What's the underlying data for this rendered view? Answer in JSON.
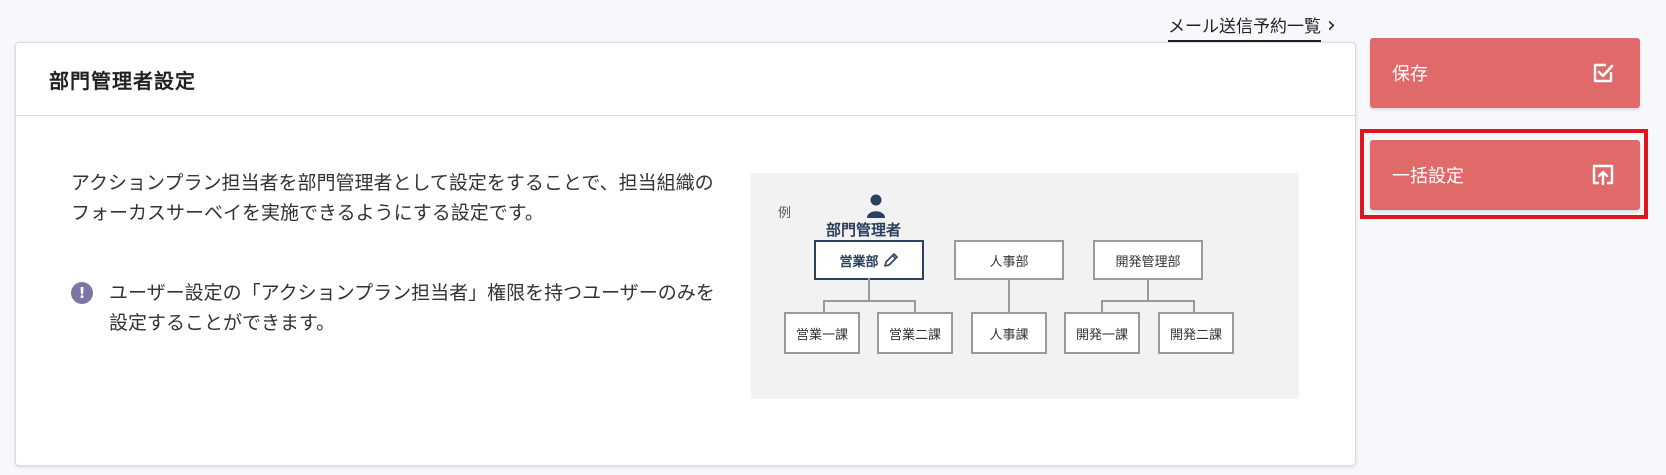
{
  "header_link": {
    "label": "メール送信予約一覧",
    "chevron": "›"
  },
  "card": {
    "title": "部門管理者設定",
    "description": "アクションプラン担当者を部門管理者として設定をすることで、担当組織のフォーカスサーベイを実施できるようにする設定です。",
    "note_icon": "!",
    "note": "ユーザー設定の「アクションプラン担当者」権限を持つユーザーのみを設定することができます。"
  },
  "example": {
    "label": "例",
    "manager_label": "部門管理者",
    "departments": [
      "営業部",
      "人事部",
      "開発管理部"
    ],
    "sections": [
      "営業一課",
      "営業二課",
      "人事課",
      "開発一課",
      "開発二課"
    ]
  },
  "actions": {
    "save_label": "保存",
    "bulk_label": "一括設定"
  },
  "colors": {
    "button_bg": "#e06a6a",
    "highlight_border": "#e0161e",
    "selected_dept": "#2b3f5e",
    "note_icon_bg": "#7b76a6"
  },
  "icons": {
    "save": "checkbox-check-icon",
    "bulk": "upload-icon",
    "manager": "person-icon",
    "edit": "pencil-icon",
    "note": "exclamation-circle-icon"
  }
}
